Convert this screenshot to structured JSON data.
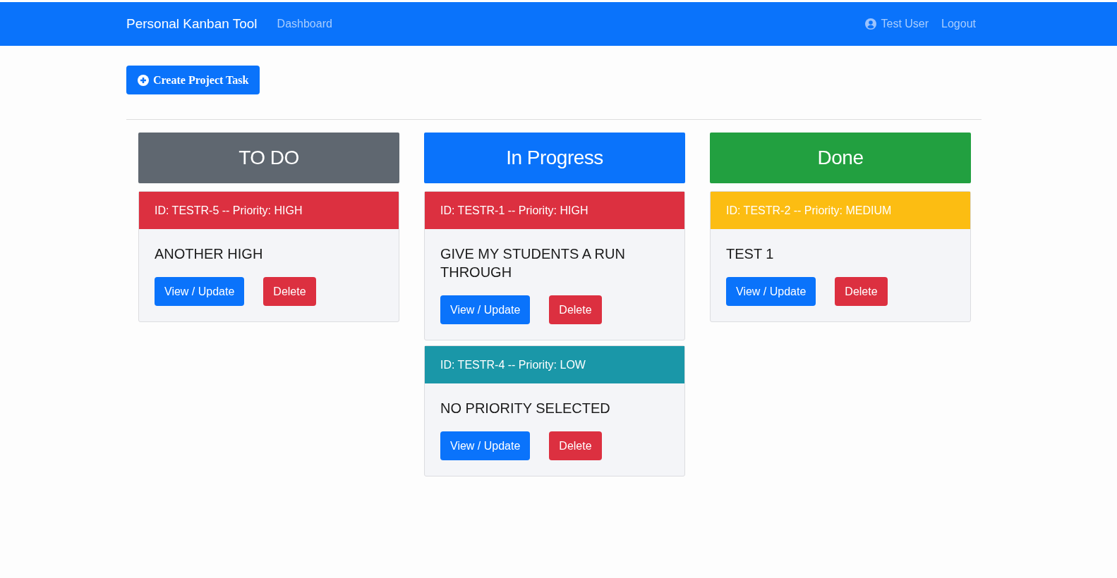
{
  "navbar": {
    "brand": "Personal Kanban Tool",
    "links": [
      "Dashboard"
    ],
    "user": "Test User",
    "logout": "Logout"
  },
  "create_button": "Create Project Task",
  "columns": [
    {
      "title": "TO DO",
      "color": "#5f6770",
      "cards": [
        {
          "header": "ID: TESTR-5 -- Priority: HIGH",
          "color": "#dc3040",
          "summary": "ANOTHER HIGH",
          "buttons": [
            "View / Update",
            "Delete"
          ]
        }
      ]
    },
    {
      "title": "In Progress",
      "color": "#0a73fb",
      "cards": [
        {
          "header": "ID: TESTR-1 -- Priority: HIGH",
          "color": "#dc3040",
          "summary": "GIVE MY STUDENTS A RUN THROUGH",
          "buttons": [
            "View / Update",
            "Delete"
          ]
        },
        {
          "header": "ID: TESTR-4 -- Priority: LOW",
          "color": "#1a97a8",
          "summary": "NO PRIORITY SELECTED",
          "buttons": [
            "View / Update",
            "Delete"
          ]
        }
      ]
    },
    {
      "title": "Done",
      "color": "#22a040",
      "cards": [
        {
          "header": "ID: TESTR-2 -- Priority: MEDIUM",
          "color": "#fcbd12",
          "summary": "TEST 1",
          "buttons": [
            "View / Update",
            "Delete"
          ]
        }
      ]
    }
  ]
}
